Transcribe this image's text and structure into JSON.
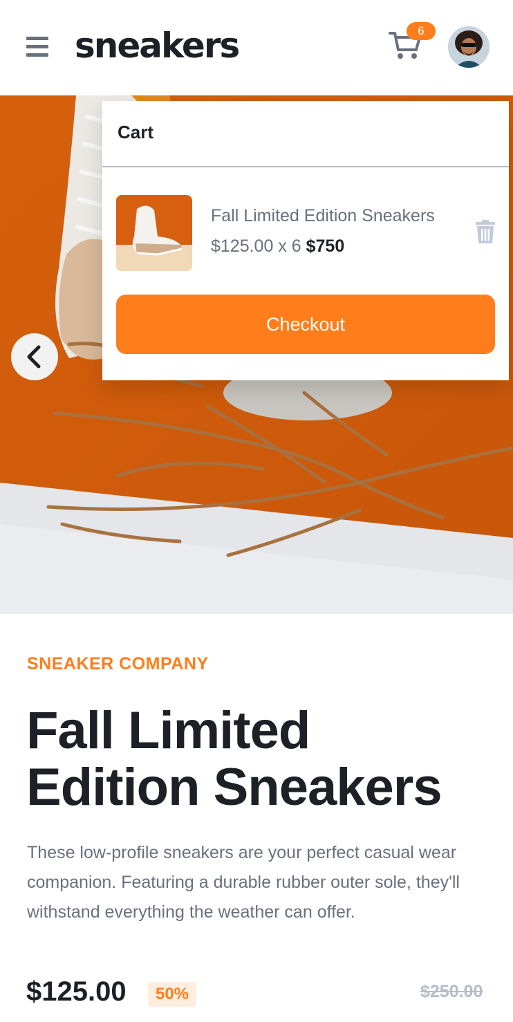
{
  "header": {
    "logo": "sneakers",
    "cart_count": "6",
    "icons": {
      "menu": "hamburger-menu-icon",
      "cart": "cart-icon",
      "avatar": "user-avatar"
    }
  },
  "hero": {
    "prev_icon": "chevron-left-icon"
  },
  "cart": {
    "title": "Cart",
    "item": {
      "name": "Fall Limited Edition Sneakers",
      "unit_price": "$125.00",
      "quantity_text": " x 6 ",
      "total": "$750"
    },
    "delete_icon": "trash-icon",
    "checkout_label": "Checkout"
  },
  "product": {
    "company": "SNEAKER COMPANY",
    "title": "Fall Limited Edition Sneakers",
    "description": "These low-profile sneakers are your perfect casual wear companion. Featuring a durable rubber outer sole, they'll withstand everything the weather can offer.",
    "price": "$125.00",
    "discount": "50%",
    "old_price": "$250.00"
  },
  "colors": {
    "accent": "#ff7e1b",
    "accent_pale": "#ffede0",
    "text_dark": "#1d2026",
    "text_gray": "#69707d",
    "text_light": "#b6bcc8",
    "hero_orange": "#d9620f"
  }
}
